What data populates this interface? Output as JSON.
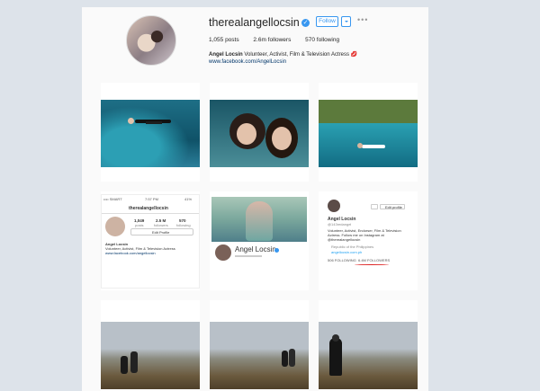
{
  "profile": {
    "username": "therealangellocsin",
    "follow_label": "Follow",
    "more_label": "•••",
    "posts": "1,055 posts",
    "followers": "2.6m followers",
    "following": "570 following",
    "name": "Angel Locsin",
    "bio": "Volunteer, Activist, Film & Television Actress",
    "link": "www.facebook.com/AngelLocsin"
  },
  "screenshot_phone": {
    "status": "•••• SMART",
    "time": "7:57 PM",
    "battery": "41%",
    "username": "therealangellocsin",
    "posts_n": "1,049",
    "posts_l": "posts",
    "followers_n": "2.5 M",
    "followers_l": "followers",
    "following_n": "570",
    "following_l": "following",
    "edit": "Edit Profile",
    "name": "Angel Locsin",
    "bio": "Volunteer, Activist, Film & Television Actress",
    "link": "www.facebook.com/angellocsin"
  },
  "screenshot_web": {
    "name": "Angel Locsin"
  },
  "screenshot_twitter": {
    "edit": "Edit profile",
    "name": "Angel Locsin",
    "handle": "@143redangel",
    "bio": "Volunteer, Activist, Endorser, Film & Television Actress. Follow me on Instagram at @therealangellocsin",
    "location": "Republic of the Philippines",
    "site": "angellocsin.com.ph",
    "following": "506 FOLLOWING",
    "followers": "6.4M FOLLOWERS"
  }
}
